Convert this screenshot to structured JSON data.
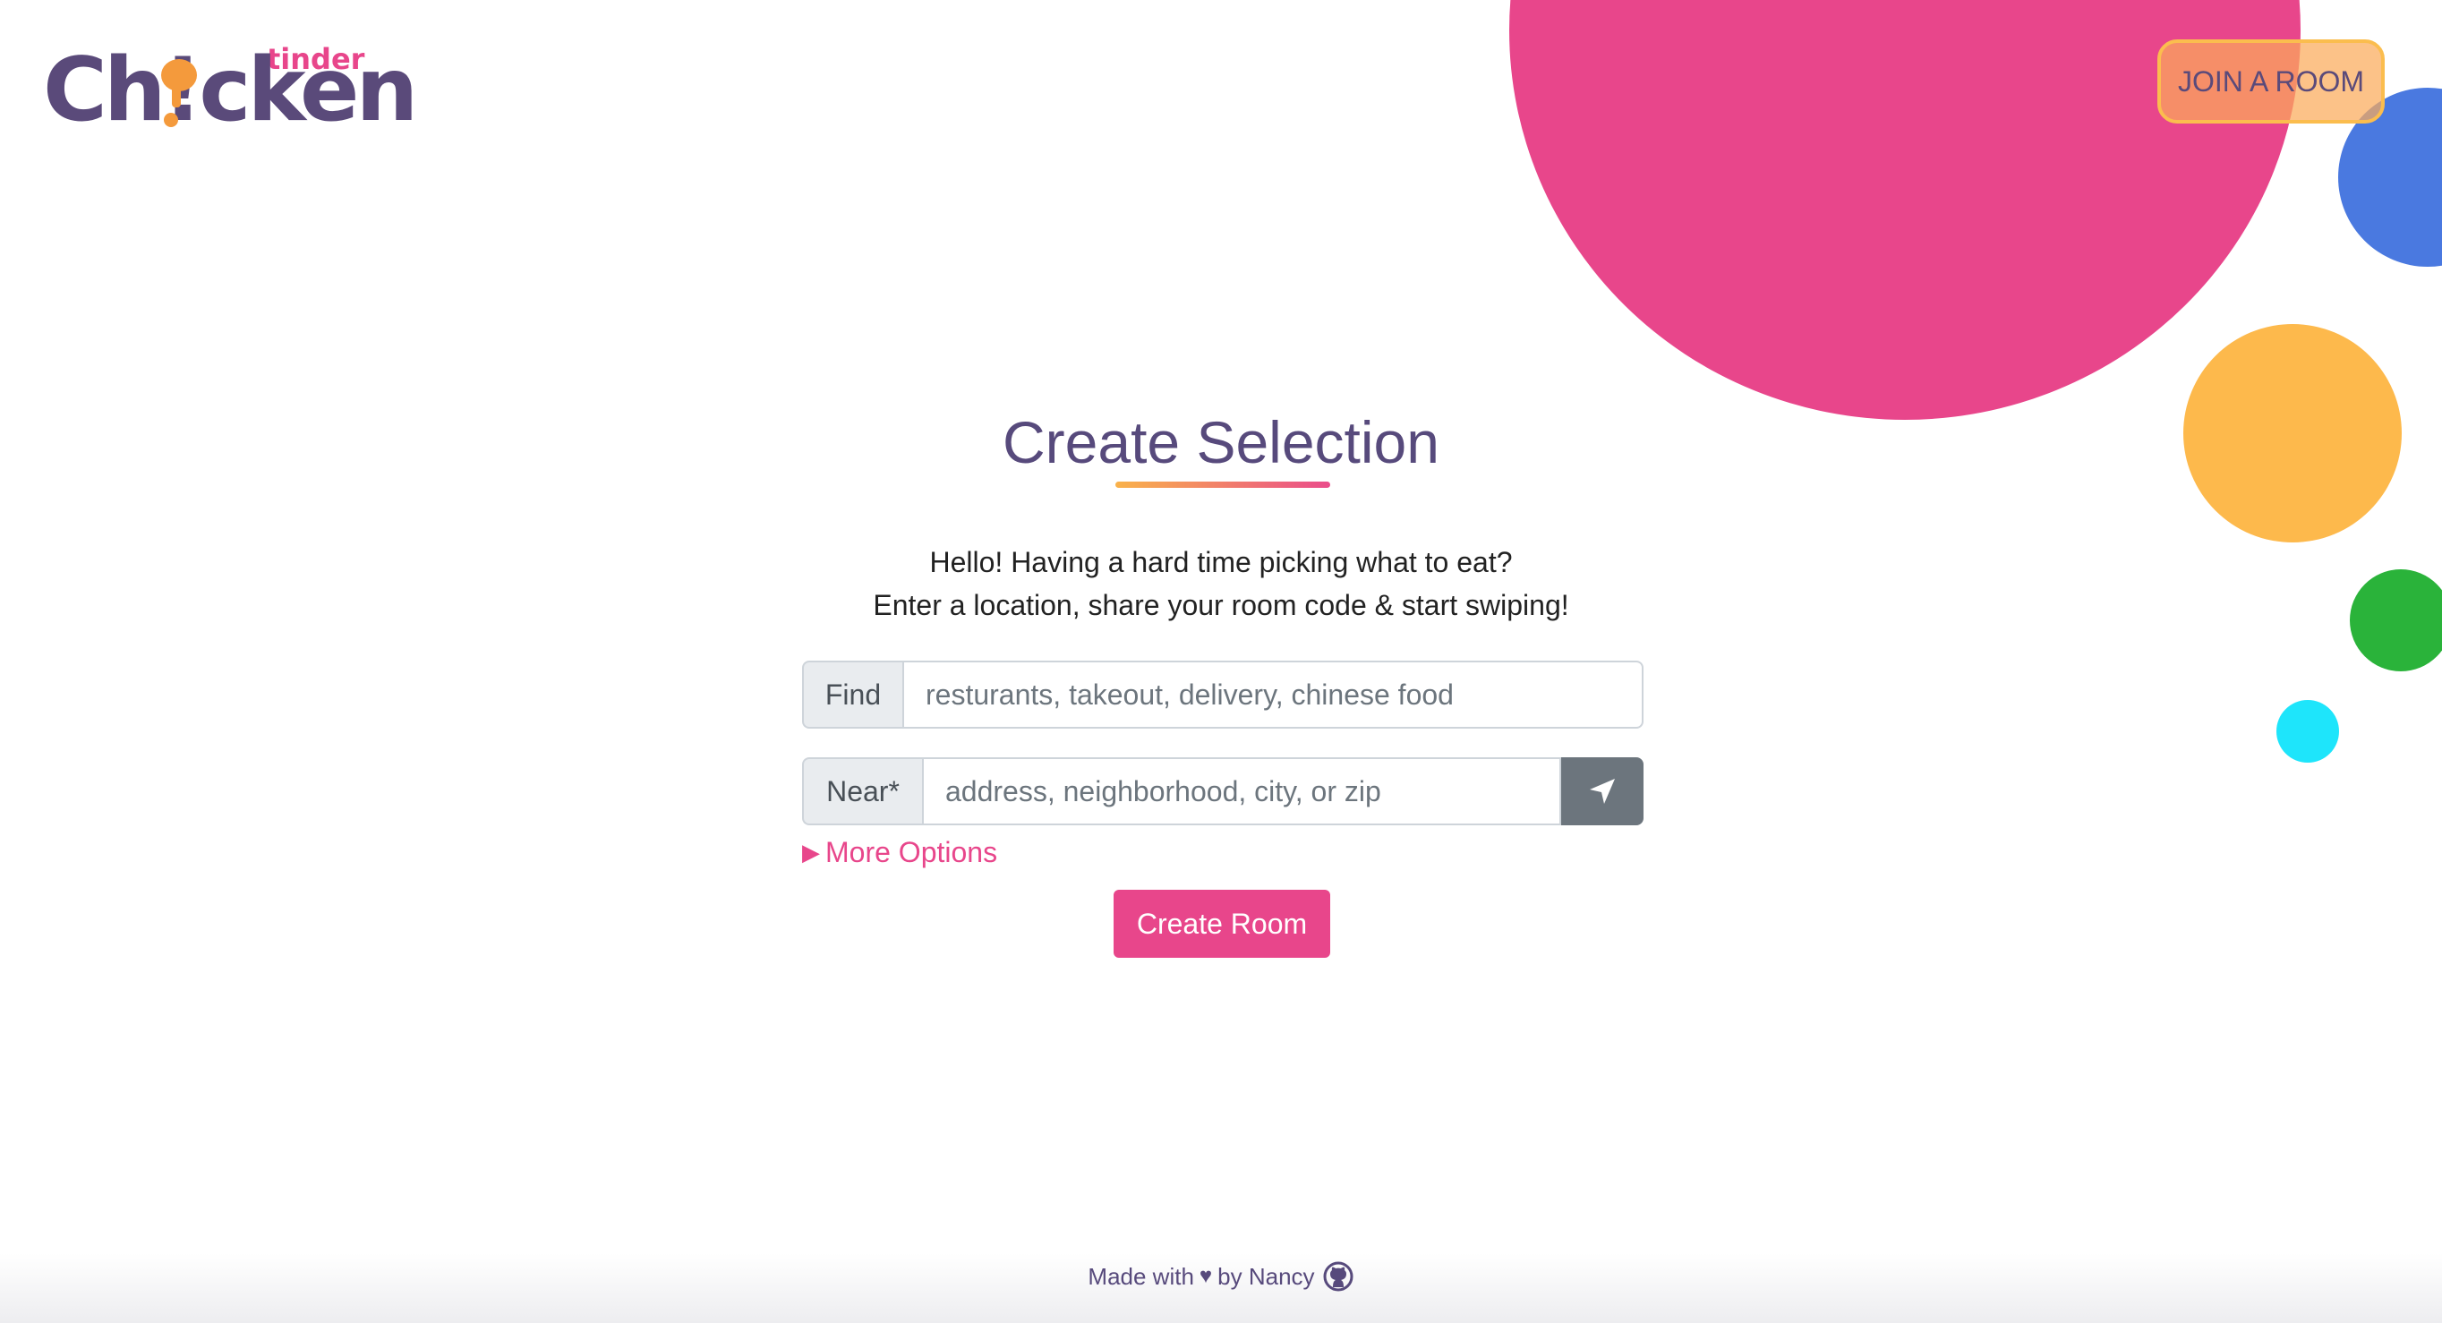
{
  "header": {
    "logo_main": "Ch!cken",
    "logo_tinder": "tinder",
    "join_label": "JOIN A ROOM"
  },
  "main": {
    "title": "Create Selection",
    "intro_line1": "Hello! Having a hard time picking what to eat?",
    "intro_line2": "Enter a location, share your room code & start swiping!",
    "find_label": "Find",
    "find_placeholder": "resturants, takeout, delivery, chinese food",
    "near_label": "Near*",
    "near_placeholder": "address, neighborhood, city, or zip",
    "more_options_label": "More Options",
    "create_label": "Create Room"
  },
  "footer": {
    "made_with": "Made with",
    "by": "by Nancy"
  },
  "colors": {
    "pink": "#e8468b",
    "blue": "#4a79e0",
    "orange": "#fdb94c",
    "green": "#2ab33a",
    "cyan": "#1ee5fb",
    "purple": "#574a7c"
  },
  "icons": {
    "locate": "location-arrow-icon",
    "heart": "heart-icon",
    "github": "github-icon",
    "caret": "caret-right-icon"
  }
}
